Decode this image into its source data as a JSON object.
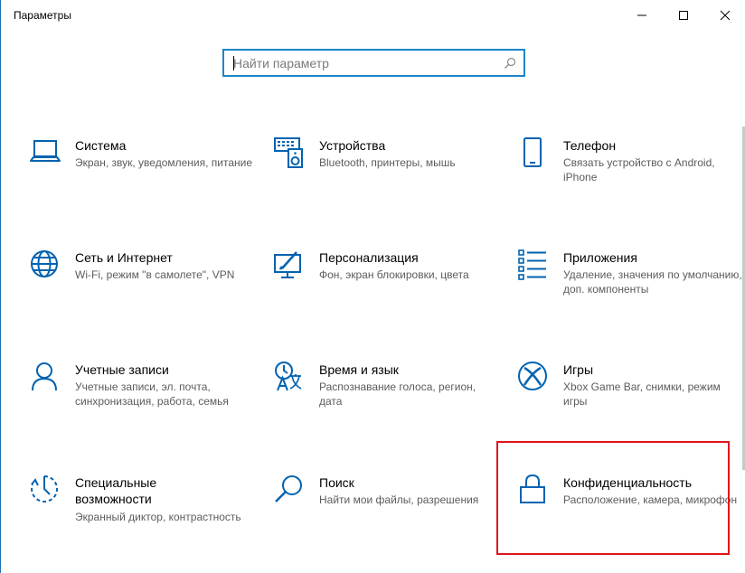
{
  "window": {
    "title": "Параметры",
    "minimize_icon": "minimize-icon",
    "maximize_icon": "maximize-icon",
    "close_icon": "close-icon"
  },
  "search": {
    "placeholder": "Найти параметр",
    "icon": "search-icon"
  },
  "tiles": [
    {
      "title": "Система",
      "desc": "Экран, звук, уведомления, питание",
      "icon": "laptop-icon"
    },
    {
      "title": "Устройства",
      "desc": "Bluetooth, принтеры, мышь",
      "icon": "keyboard-speaker-icon"
    },
    {
      "title": "Телефон",
      "desc": "Связать устройство с Android, iPhone",
      "icon": "phone-icon"
    },
    {
      "title": "Сеть и Интернет",
      "desc": "Wi-Fi, режим \"в самолете\", VPN",
      "icon": "globe-icon"
    },
    {
      "title": "Персонализация",
      "desc": "Фон, экран блокировки, цвета",
      "icon": "paint-monitor-icon"
    },
    {
      "title": "Приложения",
      "desc": "Удаление, значения по умолчанию, доп. компоненты",
      "icon": "app-list-icon"
    },
    {
      "title": "Учетные записи",
      "desc": "Учетные записи, эл. почта, синхронизация, работа, семья",
      "icon": "person-icon"
    },
    {
      "title": "Время и язык",
      "desc": "Распознавание голоса, регион, дата",
      "icon": "time-language-icon"
    },
    {
      "title": "Игры",
      "desc": "Xbox Game Bar, снимки, режим игры",
      "icon": "xbox-icon"
    },
    {
      "title": "Специальные возможности",
      "desc": "Экранный диктор, контрастность",
      "icon": "accessibility-timer-icon"
    },
    {
      "title": "Поиск",
      "desc": "Найти мои файлы, разрешения",
      "icon": "search-icon"
    },
    {
      "title": "Конфиденциальность",
      "desc": "Расположение, камера, микрофон",
      "icon": "lock-icon"
    }
  ],
  "colors": {
    "accent": "#0063b1",
    "highlight": "#e0161e",
    "search_border": "#1a86c8"
  }
}
